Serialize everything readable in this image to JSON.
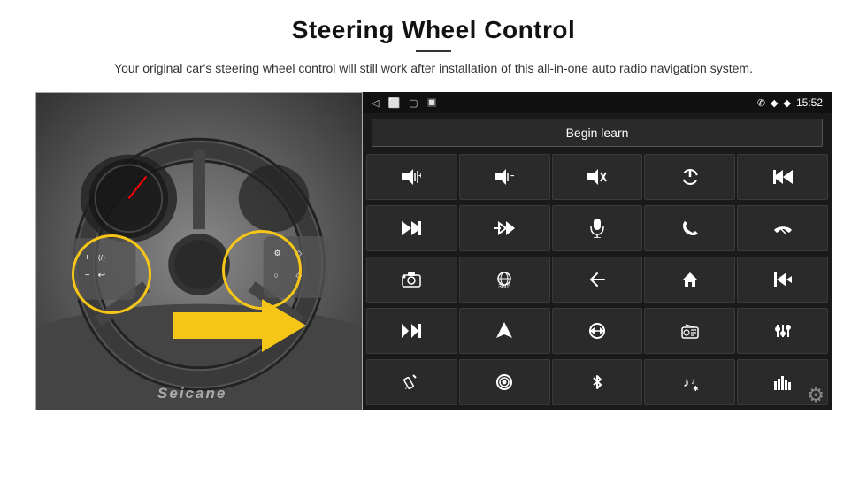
{
  "header": {
    "title": "Steering Wheel Control",
    "subtitle": "Your original car's steering wheel control will still work after installation of this all-in-one auto radio navigation system."
  },
  "statusBar": {
    "time": "15:52",
    "backIcon": "◁",
    "squircleIcon": "⬜",
    "squareIcon": "▢",
    "simIcon": "🔲",
    "phoneIcon": "✆",
    "locationIcon": "◆",
    "wifiIcon": "◆"
  },
  "beginLearn": {
    "label": "Begin learn"
  },
  "controls": [
    {
      "icon": "🔊+",
      "name": "volume-up"
    },
    {
      "icon": "🔊−",
      "name": "volume-down"
    },
    {
      "icon": "🔇",
      "name": "mute"
    },
    {
      "icon": "⏻",
      "name": "power"
    },
    {
      "icon": "⏮",
      "name": "prev-track-left"
    },
    {
      "icon": "⏭",
      "name": "next-track"
    },
    {
      "icon": "⏸⏭",
      "name": "skip-forward"
    },
    {
      "icon": "🎤",
      "name": "microphone"
    },
    {
      "icon": "📞",
      "name": "phone"
    },
    {
      "icon": "↩",
      "name": "hangup"
    },
    {
      "icon": "📷",
      "name": "camera"
    },
    {
      "icon": "360°",
      "name": "360-view"
    },
    {
      "icon": "↩",
      "name": "back"
    },
    {
      "icon": "🏠",
      "name": "home"
    },
    {
      "icon": "⏮",
      "name": "prev-track"
    },
    {
      "icon": "⏭⏭",
      "name": "fast-forward"
    },
    {
      "icon": "➤",
      "name": "navigate"
    },
    {
      "icon": "⇄",
      "name": "swap"
    },
    {
      "icon": "📻",
      "name": "radio"
    },
    {
      "icon": "⫶",
      "name": "equalizer"
    },
    {
      "icon": "✏",
      "name": "edit"
    },
    {
      "icon": "⏺",
      "name": "record"
    },
    {
      "icon": "✱",
      "name": "bluetooth"
    },
    {
      "icon": "🎵",
      "name": "music"
    },
    {
      "icon": "📊",
      "name": "sound-bars"
    }
  ],
  "watermark": {
    "text": "Seicane"
  }
}
